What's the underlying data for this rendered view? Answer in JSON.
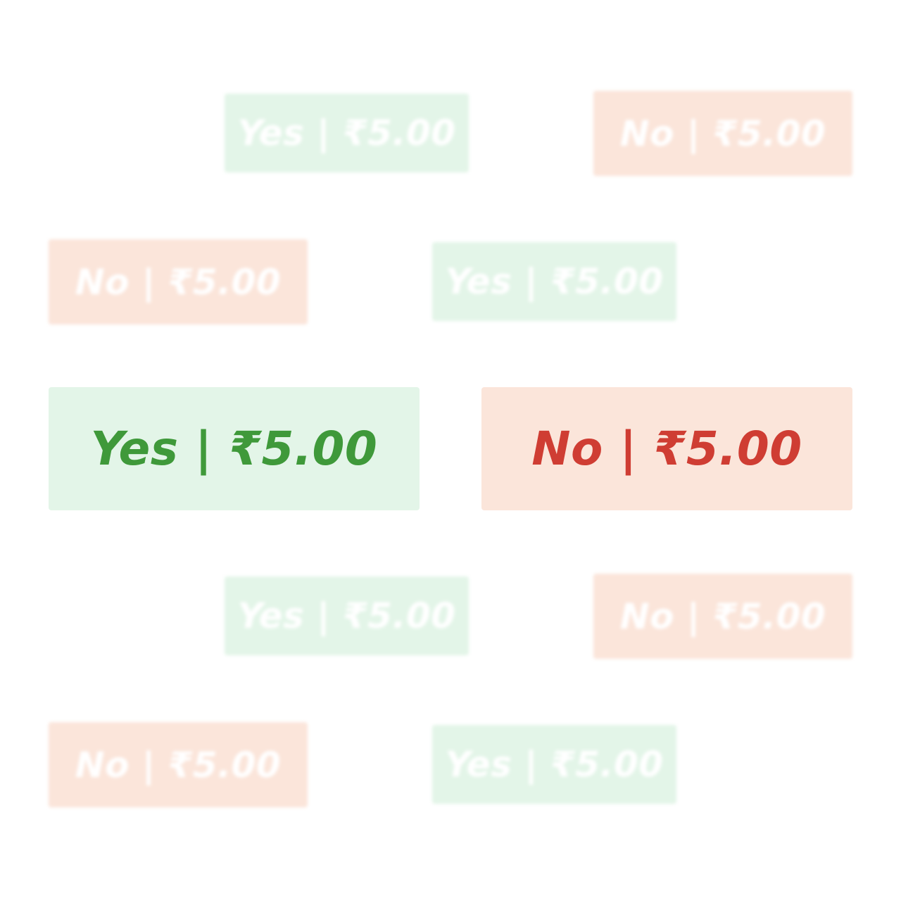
{
  "colors": {
    "yes_bg": "#e3f5e8",
    "yes_text": "#3f993a",
    "no_bg": "#fbe5da",
    "no_text": "#cf3d33",
    "ghost_text": "#ffffff"
  },
  "main": {
    "yes_label": "Yes | ₹5.00",
    "no_label": "No | ₹5.00"
  },
  "background_buttons": [
    {
      "type": "yes",
      "label": "Yes | ₹5.00"
    },
    {
      "type": "no",
      "label": "No | ₹5.00"
    },
    {
      "type": "no",
      "label": "No | ₹5.00"
    },
    {
      "type": "yes",
      "label": "Yes | ₹5.00"
    },
    {
      "type": "yes",
      "label": "Yes | ₹5.00"
    },
    {
      "type": "no",
      "label": "No | ₹5.00"
    },
    {
      "type": "no",
      "label": "No | ₹5.00"
    },
    {
      "type": "yes",
      "label": "Yes | ₹5.00"
    }
  ]
}
